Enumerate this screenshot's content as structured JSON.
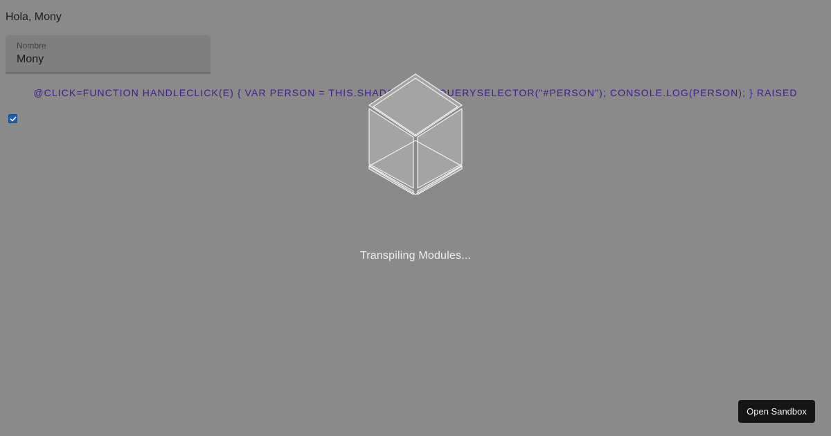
{
  "greeting": "Hola, Mony",
  "name_field": {
    "label": "Nombre",
    "value": "Mony"
  },
  "raised_button": {
    "label": "@CLICK=FUNCTION HANDLECLICK(E) { VAR PERSON = THIS.SHADOWROOT.QUERYSELECTOR(\"#PERSON\"); CONSOLE.LOG(PERSON); } RAISED LABEL=\"CLICK\">"
  },
  "checkbox": {
    "checked": true
  },
  "loader": {
    "icon": "codesandbox-cube-icon",
    "text": "Transpiling Modules..."
  },
  "open_sandbox": {
    "label": "Open Sandbox"
  },
  "colors": {
    "overlay_background": "#8a8a8a",
    "button_text": "#3e1c8f",
    "checkbox_accent": "#1f5fb0",
    "open_sandbox_background": "#151515"
  }
}
